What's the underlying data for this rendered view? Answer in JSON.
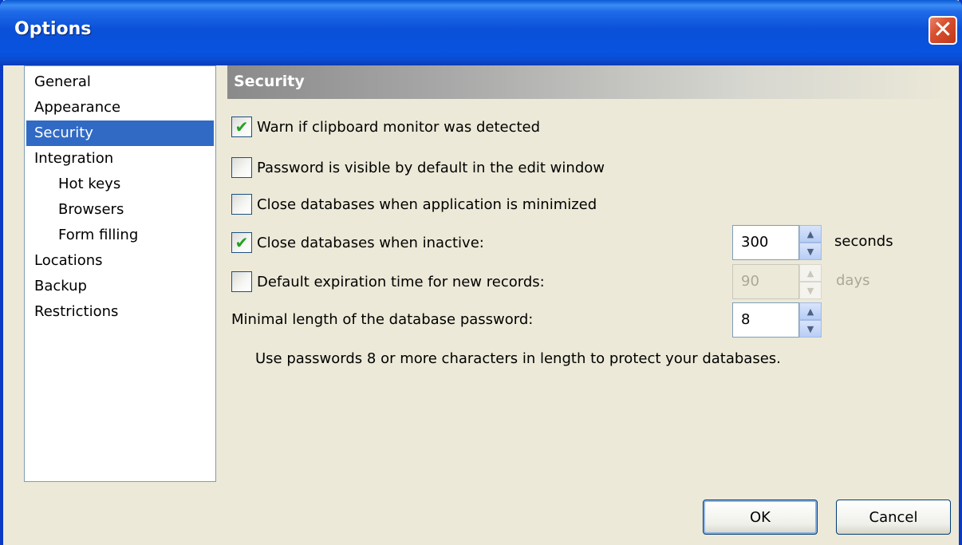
{
  "window": {
    "title": "Options",
    "close_glyph": "✕"
  },
  "nav": {
    "items": [
      {
        "label": "General",
        "level": 0,
        "selected": false
      },
      {
        "label": "Appearance",
        "level": 0,
        "selected": false
      },
      {
        "label": "Security",
        "level": 0,
        "selected": true
      },
      {
        "label": "Integration",
        "level": 0,
        "selected": false
      },
      {
        "label": "Hot keys",
        "level": 1,
        "selected": false
      },
      {
        "label": "Browsers",
        "level": 1,
        "selected": false
      },
      {
        "label": "Form filling",
        "level": 1,
        "selected": false
      },
      {
        "label": "Locations",
        "level": 0,
        "selected": false
      },
      {
        "label": "Backup",
        "level": 0,
        "selected": false
      },
      {
        "label": "Restrictions",
        "level": 0,
        "selected": false
      }
    ]
  },
  "section": {
    "title": "Security"
  },
  "options": {
    "warn_clipboard": {
      "label": "Warn if clipboard monitor was detected",
      "checked": true
    },
    "password_visible": {
      "label": "Password is visible by default in the edit window",
      "checked": false
    },
    "close_minimized": {
      "label": "Close databases when application is minimized",
      "checked": false
    },
    "close_inactive": {
      "label": "Close databases when inactive:",
      "checked": true,
      "value": "300",
      "unit": "seconds"
    },
    "default_expiration": {
      "label": "Default expiration time for new records:",
      "checked": false,
      "value": "90",
      "unit": "days",
      "disabled": true
    },
    "min_length": {
      "label": "Minimal length of the database password:",
      "value": "8"
    },
    "hint": "Use passwords 8 or more characters in length to protect your databases."
  },
  "buttons": {
    "ok": "OK",
    "cancel": "Cancel"
  },
  "glyphs": {
    "check": "✔",
    "spin_up": "▲",
    "spin_down": "▼"
  },
  "colors": {
    "selection": "#316ac5",
    "titlebar": "#0a50d8",
    "face": "#ece9d8"
  }
}
